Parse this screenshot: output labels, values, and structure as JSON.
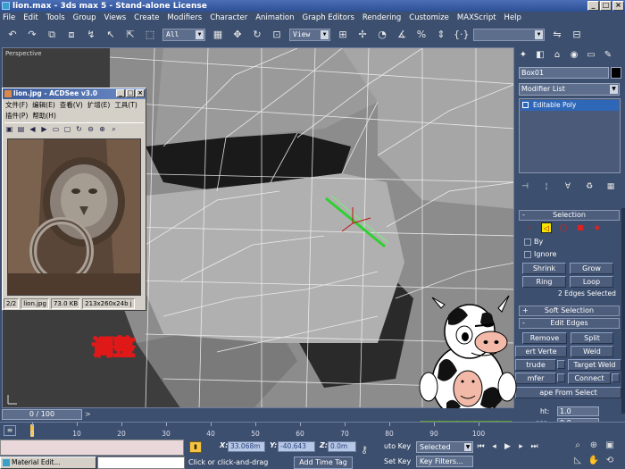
{
  "window": {
    "title": "lion.max - 3ds max 5 - Stand-alone License",
    "controls": [
      "_",
      "□",
      "×"
    ]
  },
  "menu": [
    "File",
    "Edit",
    "Tools",
    "Group",
    "Views",
    "Create",
    "Modifiers",
    "Character",
    "Animation",
    "Graph Editors",
    "Rendering",
    "Customize",
    "MAXScript",
    "Help"
  ],
  "toolbar": {
    "selection_filter": "All",
    "reference_coord": "View"
  },
  "viewport": {
    "label": "Perspective"
  },
  "acdsee": {
    "title": "lion.jpg - ACDSee v3.0",
    "menu": [
      "文件(F)",
      "编辑(E)",
      "查看(V)",
      "扩增(E)",
      "工具(T)",
      "插件(P)",
      "帮助(H)"
    ],
    "status": {
      "index": "2/2",
      "filename": "lion.jpg",
      "size": "73.0 KB",
      "dims": "213x260x24b j"
    }
  },
  "command_panel": {
    "object_name": "Box01",
    "modifier_list": "Modifier List",
    "stack_item": "Editable Poly",
    "selection": {
      "title": "Selection",
      "by_label": "By",
      "ignore_label": "Ignore",
      "shrink": "Shrink",
      "grow": "Grow",
      "ring": "Ring",
      "loop": "Loop",
      "edges_selected": "2 Edges Selected"
    },
    "soft_selection": "Soft Selection",
    "edit_edges": {
      "title": "Edit Edges",
      "remove": "Remove",
      "split": "Split",
      "insert_vertex": "ert Verte",
      "weld": "Weld",
      "extrude": "trude",
      "target_weld": "Target Weld",
      "chamfer": "mfer",
      "connect": "Connect",
      "create_shape": "ape From Select",
      "weight_label": "ht:",
      "weight_value": "1.0",
      "crease_label": "ase:",
      "crease_value": "0.0"
    }
  },
  "timeline": {
    "frame": "0 / 100",
    "ticks": [
      "0",
      "10",
      "20",
      "30",
      "40",
      "50",
      "60",
      "70",
      "80",
      "90",
      "100"
    ]
  },
  "statusbar": {
    "task_label": "Material Edit...",
    "coords": {
      "x_label": "X:",
      "x": "33.068m",
      "y_label": "Y:",
      "y": "-40.643",
      "z_label": "Z:",
      "z": "0.0m"
    },
    "prompt": "Click or click-and-drag",
    "add_time_tag": "Add Time Tag",
    "auto_key": "uto Key",
    "set_key": "Set Key",
    "key_mode": "Selected",
    "key_filters": "Key Filters..."
  },
  "overlay_text": "调整",
  "colors": {
    "ui_background": "#3c4f6e",
    "viewport_background": "#3d3d3d",
    "selected_edge": "#2fd02f",
    "overlay_text": "#e01818",
    "stack_selected": "#2f67b8"
  }
}
